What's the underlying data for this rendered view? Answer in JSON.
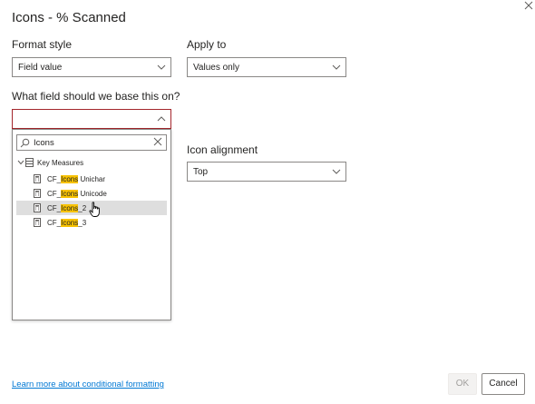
{
  "dialog": {
    "title": "Icons - % Scanned",
    "close_icon": "close-icon"
  },
  "format_style": {
    "label": "Format style",
    "value": "Field value"
  },
  "apply_to": {
    "label": "Apply to",
    "value": "Values only"
  },
  "base_field": {
    "label": "What field should we base this on?",
    "value": "",
    "search_text": "Icons",
    "group": "Key Measures",
    "items": [
      {
        "prefix": "CF_",
        "match": "Icons",
        "suffix": " Unichar"
      },
      {
        "prefix": "CF_",
        "match": "Icons",
        "suffix": " Unicode"
      },
      {
        "prefix": "CF_",
        "match": "Icons",
        "suffix": "_2"
      },
      {
        "prefix": "CF_",
        "match": "Icons",
        "suffix": "_3"
      }
    ],
    "hovered_index": 2
  },
  "icon_alignment": {
    "label": "Icon alignment",
    "value": "Top"
  },
  "footer": {
    "learn_more": "Learn more about conditional formatting",
    "ok": "OK",
    "cancel": "Cancel"
  },
  "colors": {
    "highlight": "#f8c200",
    "link": "#0078d4",
    "error_border": "#a4262c"
  }
}
